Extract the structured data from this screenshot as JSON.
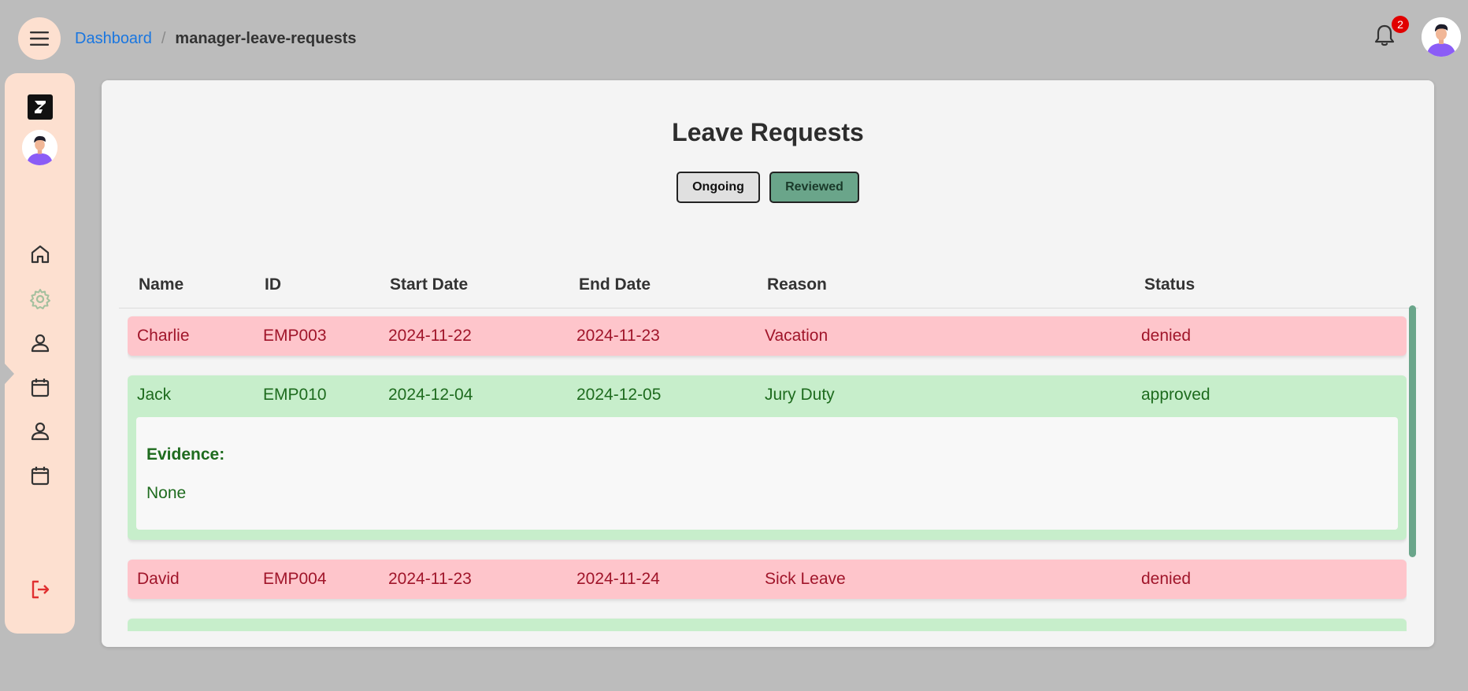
{
  "breadcrumb": {
    "home": "Dashboard",
    "separator": "/",
    "current": "manager-leave-requests"
  },
  "notifications": {
    "count": "2",
    "icon": "bell-icon"
  },
  "sidebar": {
    "items": [
      {
        "icon": "home-icon",
        "active": false
      },
      {
        "icon": "gear-icon",
        "active": true
      },
      {
        "icon": "user-icon",
        "active": false
      },
      {
        "icon": "calendar-icon",
        "active": false
      },
      {
        "icon": "user-icon",
        "active": false
      },
      {
        "icon": "calendar-icon",
        "active": false
      },
      {
        "icon": "logout-icon",
        "active": false
      }
    ]
  },
  "page": {
    "title": "Leave Requests"
  },
  "tabs": {
    "ongoing": "Ongoing",
    "reviewed": "Reviewed",
    "selected": "Reviewed"
  },
  "table": {
    "headers": {
      "name": "Name",
      "id": "ID",
      "start": "Start Date",
      "end": "End Date",
      "reason": "Reason",
      "status": "Status"
    },
    "rows": [
      {
        "name": "Charlie",
        "id": "EMP003",
        "start": "2024-11-22",
        "end": "2024-11-23",
        "reason": "Vacation",
        "status": "denied"
      },
      {
        "name": "Jack",
        "id": "EMP010",
        "start": "2024-12-04",
        "end": "2024-12-05",
        "reason": "Jury Duty",
        "status": "approved",
        "evidence_label": "Evidence:",
        "evidence_value": "None"
      },
      {
        "name": "David",
        "id": "EMP004",
        "start": "2024-11-23",
        "end": "2024-11-24",
        "reason": "Sick Leave",
        "status": "denied"
      }
    ]
  },
  "colors": {
    "sidebar_bg": "#fde0d0",
    "denied_bg": "#fec5cb",
    "denied_text": "#a0152a",
    "approved_bg": "#c7eecb",
    "approved_text": "#1e6b1e",
    "accent": "#6aa58a",
    "link": "#1976e0"
  }
}
